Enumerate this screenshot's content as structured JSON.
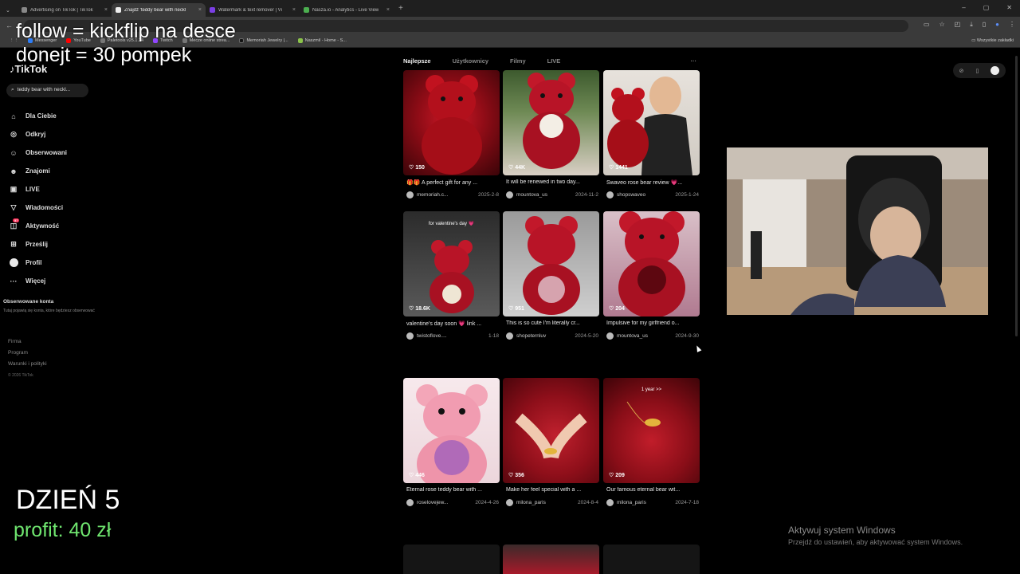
{
  "browser": {
    "tabs": [
      {
        "title": "Advertising on TikTok | TikTok",
        "color": "#888888"
      },
      {
        "title": "Znajdź 'teddy bear with neckl",
        "color": "#111111",
        "active": true
      },
      {
        "title": "Watermark & text remover | Vi",
        "color": "#7b3fe4"
      },
      {
        "title": "Nasza.io - Analytics - Live View",
        "color": "#4caf50"
      }
    ],
    "new_tab": "+",
    "url": "",
    "bookmarks": [
      "Messenger",
      "YouTube",
      "Paletools v25.1.24",
      "Twitch",
      "Mecze online strea...",
      "Memoriah Jewelry |...",
      "Naszmil - Home - S..."
    ],
    "bookmarks_all": "Wszystkie zakładki"
  },
  "overlay": {
    "line1": "follow = kickflip na desce",
    "line2": "donejt = 30 pompek",
    "day": "DZIEŃ 5",
    "profit": "profit: 40 zł"
  },
  "tiktok": {
    "logo": "TikTok",
    "search_value": "teddy bear with neckl...",
    "nav": [
      {
        "label": "Dla Ciebie",
        "icon": "home-icon"
      },
      {
        "label": "Odkryj",
        "icon": "compass-icon"
      },
      {
        "label": "Obserwowani",
        "icon": "following-icon"
      },
      {
        "label": "Znajomi",
        "icon": "friends-icon"
      },
      {
        "label": "LIVE",
        "icon": "live-icon"
      },
      {
        "label": "Wiadomości",
        "icon": "messages-icon"
      },
      {
        "label": "Aktywność",
        "icon": "activity-icon",
        "badge": "57"
      },
      {
        "label": "Prześlij",
        "icon": "upload-icon"
      },
      {
        "label": "Profil",
        "icon": "profile-icon"
      },
      {
        "label": "Więcej",
        "icon": "more-icon"
      }
    ],
    "followed_title": "Obserwowane konta",
    "followed_sub": "Tutaj pojawią się konta, które będziesz obserwować",
    "footer": [
      "Firma",
      "Program",
      "Warunki i polityki"
    ],
    "copyright": "© 2026 TikTok",
    "result_tabs": [
      "Najlepsze",
      "Użytkownicy",
      "Filmy",
      "LIVE"
    ],
    "result_more": "···",
    "videos": [
      {
        "likes": "150",
        "caption": "🎁🎁 A perfect gift for any ...",
        "user": "memoriah.c...",
        "date": "2025-2-8"
      },
      {
        "likes": "44K",
        "caption": "It will be renewed in two day...",
        "user": "mountova_us",
        "date": "2024-11-2"
      },
      {
        "likes": "1441",
        "caption": "Swaveo rose bear review 💗...",
        "user": "shopswaveo",
        "date": "2025-1-24"
      },
      {
        "likes": "18.6K",
        "caption": "valentine's day soon 💗 link ...",
        "user": "twistoflove....",
        "date": "1-18",
        "tag": "for valentine's day 💗"
      },
      {
        "likes": "951",
        "caption": "This is so cute I'm literally cr...",
        "user": "shopeternluv",
        "date": "2024-5-20"
      },
      {
        "likes": "204",
        "caption": "Impulsive for my girlfriend o...",
        "user": "mountova_us",
        "date": "2024-9-30"
      },
      {
        "likes": "446",
        "caption": "Eternal rose teddy bear with ...",
        "user": "roselovejew...",
        "date": "2024-4-26"
      },
      {
        "likes": "356",
        "caption": "Make her feel special with a ...",
        "user": "milona_paris",
        "date": "2024-8-4"
      },
      {
        "likes": "209",
        "caption": "Our famous eternal bear wit...",
        "user": "milona_paris",
        "date": "2024-7-18",
        "tag": "1 year >>"
      }
    ]
  },
  "windows_watermark": {
    "title": "Aktywuj system Windows",
    "sub": "Przejdź do ustawień, aby aktywować system Windows."
  }
}
